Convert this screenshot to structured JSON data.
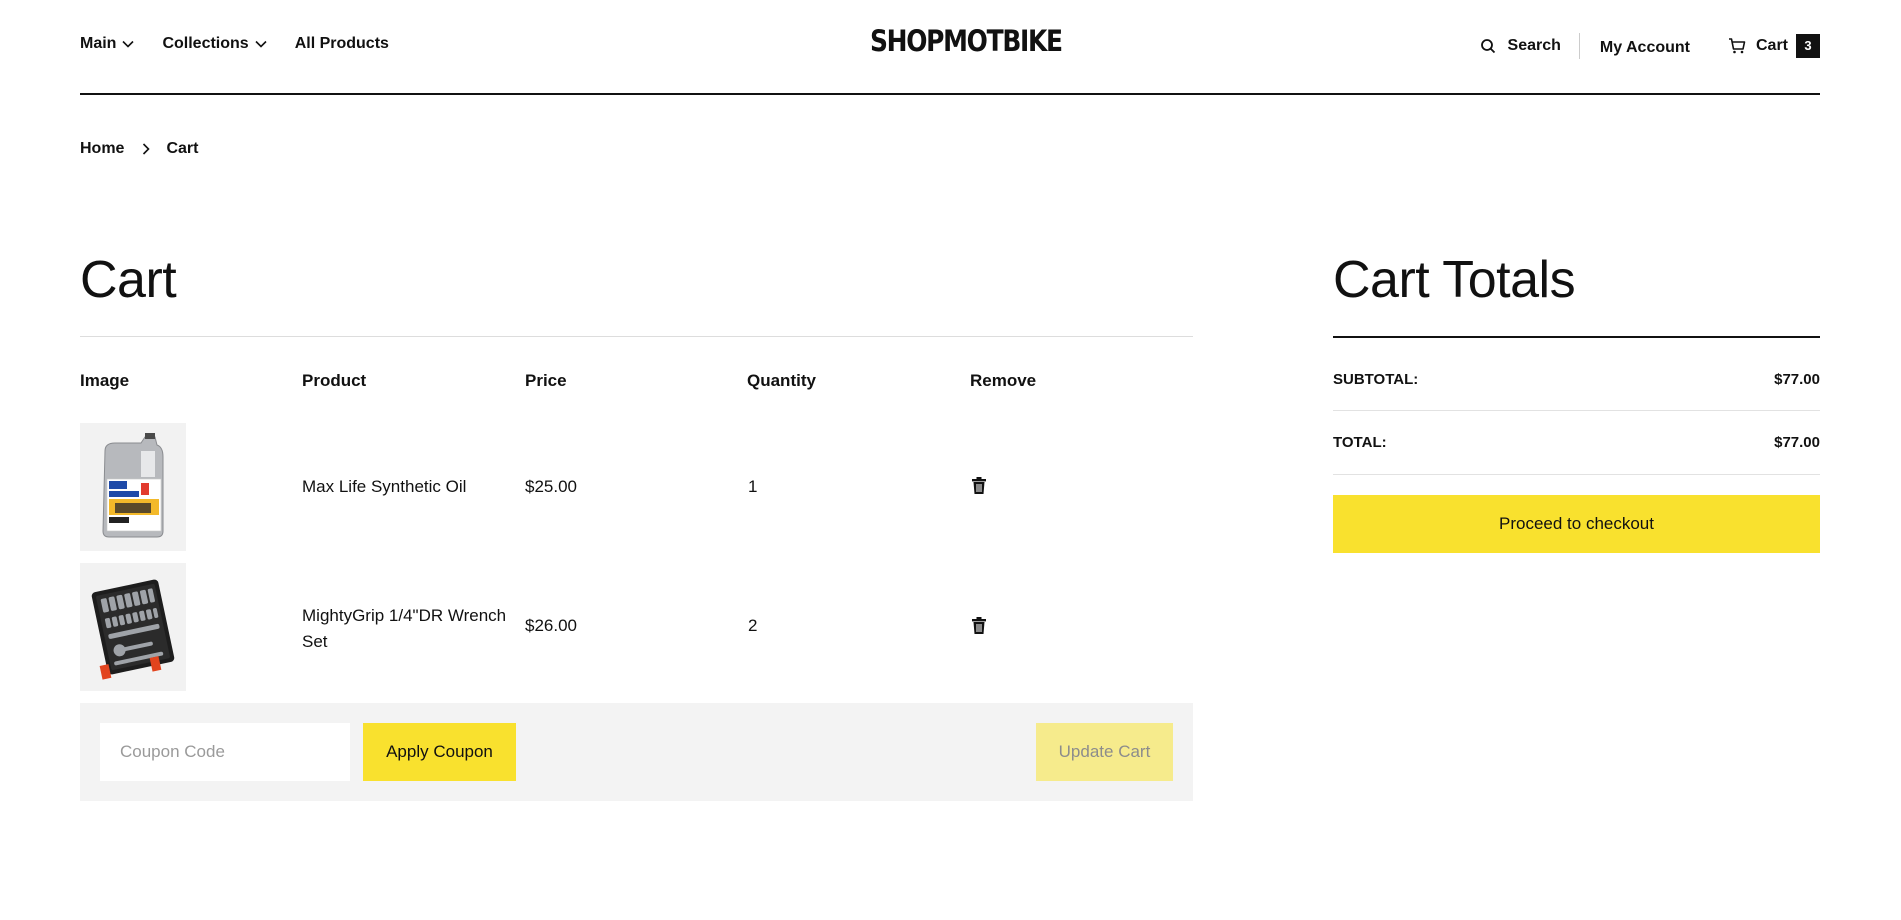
{
  "header": {
    "nav": [
      {
        "label": "Main",
        "has_dropdown": true
      },
      {
        "label": "Collections",
        "has_dropdown": true
      },
      {
        "label": "All Products",
        "has_dropdown": false
      }
    ],
    "logo": "SHOPMOTBIKE",
    "search_label": "Search",
    "account_label": "My Account",
    "cart_label": "Cart",
    "cart_count": "3"
  },
  "breadcrumb": {
    "home": "Home",
    "current": "Cart"
  },
  "cart": {
    "title": "Cart",
    "columns": [
      "Image",
      "Product",
      "Price",
      "Quantity",
      "Remove"
    ],
    "items": [
      {
        "product": "Max Life Synthetic Oil",
        "price": "$25.00",
        "quantity": "1",
        "image_icon": "oil-jug-image"
      },
      {
        "product": "MightyGrip 1/4\"DR Wrench Set",
        "price": "$26.00",
        "quantity": "2",
        "image_icon": "wrench-set-image"
      }
    ],
    "coupon_placeholder": "Coupon Code",
    "apply_label": "Apply Coupon",
    "update_label": "Update Cart"
  },
  "totals": {
    "title": "Cart Totals",
    "subtotal_label": "SUBTOTAL:",
    "subtotal_value": "$77.00",
    "total_label": "TOTAL:",
    "total_value": "$77.00",
    "checkout_label": "Proceed to checkout"
  },
  "colors": {
    "accent_yellow": "#f9e12e",
    "disabled_yellow": "#f6eb8c",
    "text": "#111111",
    "muted_panel": "#f3f3f3"
  }
}
